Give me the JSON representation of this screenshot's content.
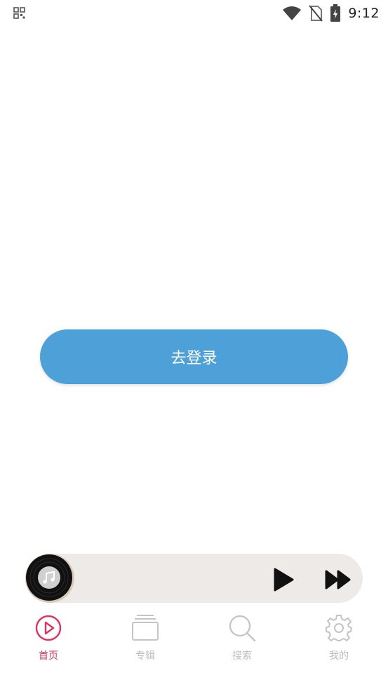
{
  "status_bar": {
    "time": "9:12",
    "icons": [
      "app-grid-icon",
      "wifi-icon",
      "no-sim-icon",
      "battery-charging-icon"
    ]
  },
  "main": {
    "login_label": "去登录"
  },
  "player": {
    "icons": [
      "vinyl-record-icon",
      "music-note-icon",
      "play-icon",
      "fast-forward-icon"
    ]
  },
  "bottom_nav": {
    "items": [
      {
        "label": "首页",
        "icon": "play-circle-icon",
        "active": true
      },
      {
        "label": "专辑",
        "icon": "album-stack-icon",
        "active": false
      },
      {
        "label": "搜索",
        "icon": "search-icon",
        "active": false
      },
      {
        "label": "我的",
        "icon": "gear-icon",
        "active": false
      }
    ]
  },
  "colors": {
    "accent": "#e0325b",
    "login_button": "#4da1d8",
    "player_bar": "#eeeae8",
    "inactive": "#bdbdbd"
  }
}
